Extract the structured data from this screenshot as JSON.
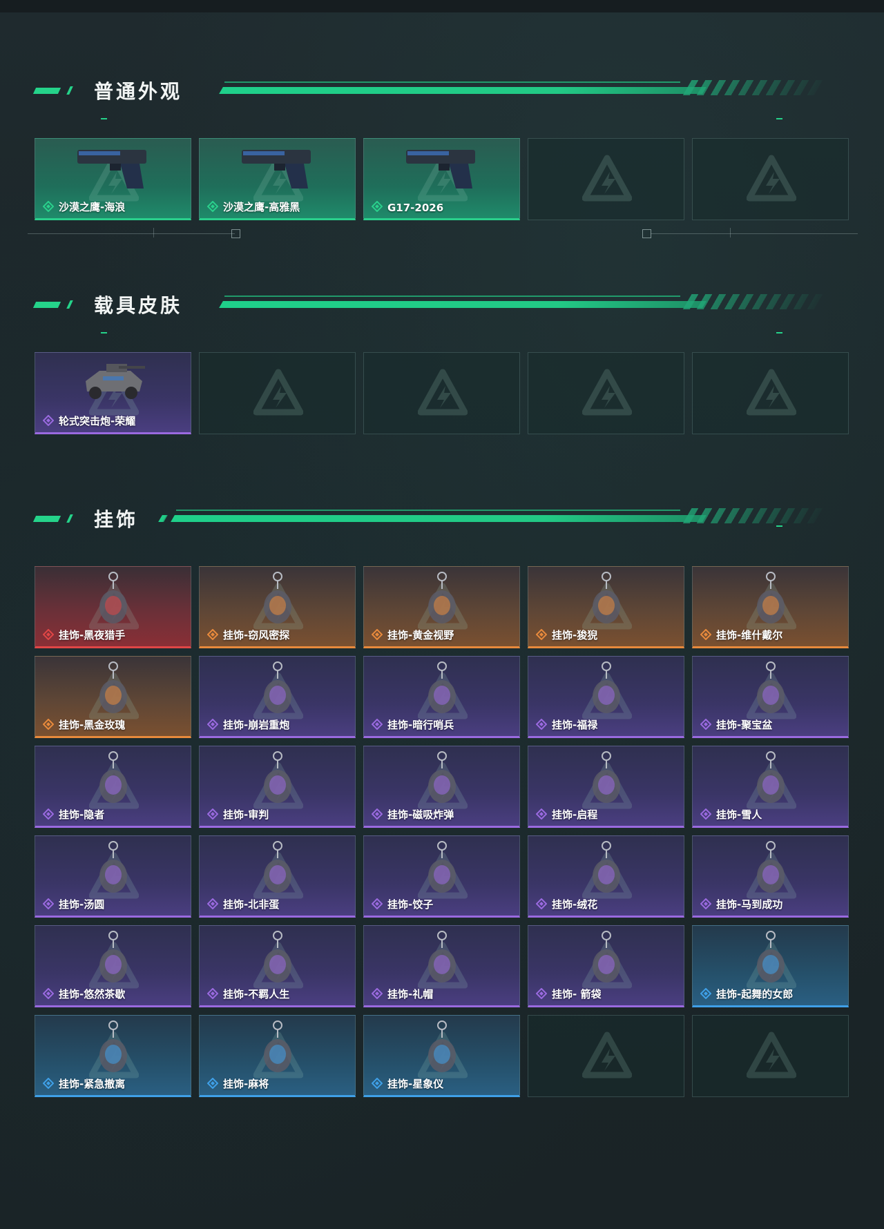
{
  "sections": [
    {
      "title": "普通外观",
      "items": [
        {
          "name": "沙漠之鹰-海浪",
          "rarity": "green",
          "icon": "pistol-icon"
        },
        {
          "name": "沙漠之鹰-高雅黑",
          "rarity": "green",
          "icon": "pistol-icon"
        },
        {
          "name": "G17-2026",
          "rarity": "green",
          "icon": "pistol-icon"
        },
        {
          "empty": true
        },
        {
          "empty": true
        }
      ]
    },
    {
      "title": "载具皮肤",
      "items": [
        {
          "name": "轮式突击炮-荣耀",
          "rarity": "purple",
          "icon": "vehicle-icon"
        },
        {
          "empty": true
        },
        {
          "empty": true
        },
        {
          "empty": true
        },
        {
          "empty": true
        }
      ]
    },
    {
      "title": "挂饰",
      "items": [
        {
          "name": "挂饰-黑夜猎手",
          "rarity": "red",
          "icon": "charm-icon"
        },
        {
          "name": "挂饰-窃风密探",
          "rarity": "orange",
          "icon": "charm-icon"
        },
        {
          "name": "挂饰-黄金视野",
          "rarity": "orange",
          "icon": "charm-icon"
        },
        {
          "name": "挂饰-狻猊",
          "rarity": "orange",
          "icon": "charm-icon"
        },
        {
          "name": "挂饰-维什戴尔",
          "rarity": "orange",
          "icon": "charm-icon"
        },
        {
          "name": "挂饰-黑金玫瑰",
          "rarity": "orange",
          "icon": "charm-icon"
        },
        {
          "name": "挂饰-崩岩重炮",
          "rarity": "purple",
          "icon": "charm-icon"
        },
        {
          "name": "挂饰-暗行哨兵",
          "rarity": "purple",
          "icon": "charm-icon"
        },
        {
          "name": "挂饰-福禄",
          "rarity": "purple",
          "icon": "charm-icon"
        },
        {
          "name": "挂饰-聚宝盆",
          "rarity": "purple",
          "icon": "charm-icon"
        },
        {
          "name": "挂饰-隐者",
          "rarity": "purple",
          "icon": "charm-icon"
        },
        {
          "name": "挂饰-审判",
          "rarity": "purple",
          "icon": "charm-icon"
        },
        {
          "name": "挂饰-磁吸炸弹",
          "rarity": "purple",
          "icon": "charm-icon"
        },
        {
          "name": "挂饰-启程",
          "rarity": "purple",
          "icon": "charm-icon"
        },
        {
          "name": "挂饰-雪人",
          "rarity": "purple",
          "icon": "charm-icon"
        },
        {
          "name": "挂饰-汤圆",
          "rarity": "purple",
          "icon": "charm-icon"
        },
        {
          "name": "挂饰-北非蛋",
          "rarity": "purple",
          "icon": "charm-icon"
        },
        {
          "name": "挂饰-饺子",
          "rarity": "purple",
          "icon": "charm-icon"
        },
        {
          "name": "挂饰-绒花",
          "rarity": "purple",
          "icon": "charm-icon"
        },
        {
          "name": "挂饰-马到成功",
          "rarity": "purple",
          "icon": "charm-icon"
        },
        {
          "name": "挂饰-悠然茶歇",
          "rarity": "purple",
          "icon": "charm-icon"
        },
        {
          "name": "挂饰-不羁人生",
          "rarity": "purple",
          "icon": "charm-icon"
        },
        {
          "name": "挂饰-礼帽",
          "rarity": "purple",
          "icon": "charm-icon"
        },
        {
          "name": "挂饰- 箭袋",
          "rarity": "purple",
          "icon": "charm-icon"
        },
        {
          "name": "挂饰-起舞的女郎",
          "rarity": "blue",
          "icon": "charm-icon"
        },
        {
          "name": "挂饰-紧急撤离",
          "rarity": "blue",
          "icon": "charm-icon"
        },
        {
          "name": "挂饰-麻将",
          "rarity": "blue",
          "icon": "charm-icon"
        },
        {
          "name": "挂饰-星象仪",
          "rarity": "blue",
          "icon": "charm-icon"
        },
        {
          "empty": true
        },
        {
          "empty": true
        }
      ]
    }
  ],
  "colors": {
    "accent": "#25d38a",
    "green": "#2ad08c",
    "purple": "#9a6ae0",
    "orange": "#e88a3c",
    "red": "#e04646",
    "blue": "#3fa0e8"
  }
}
